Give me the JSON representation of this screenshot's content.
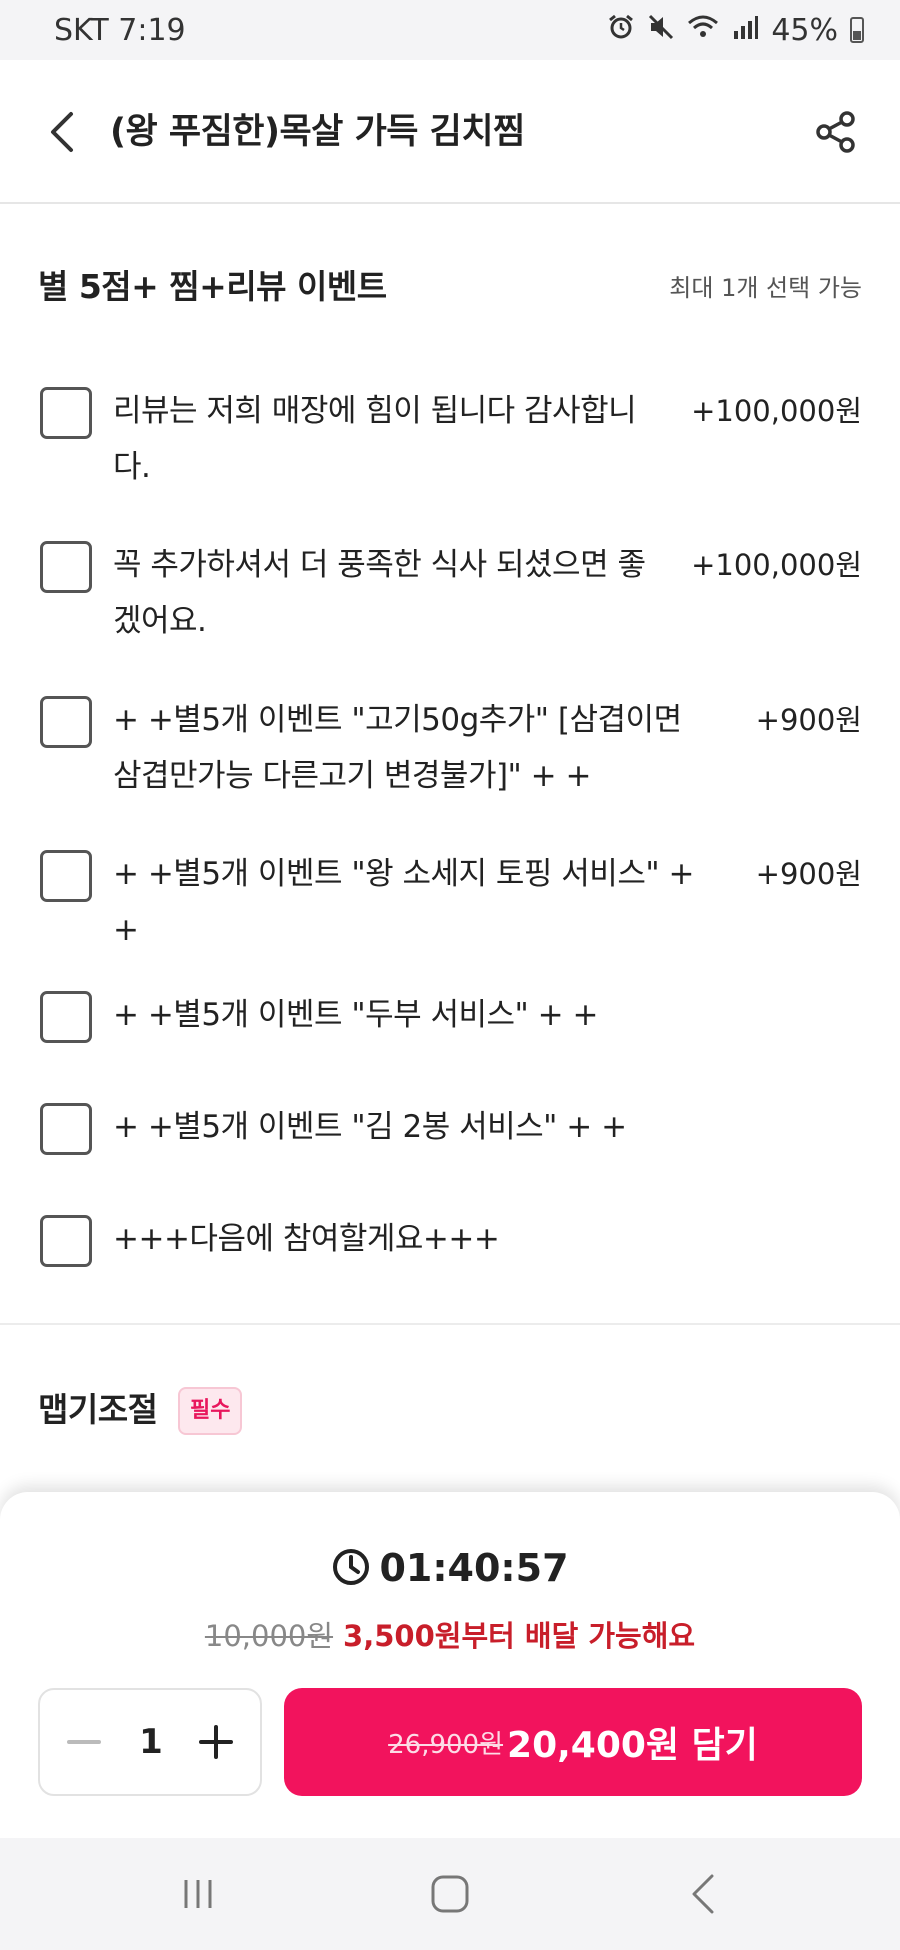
{
  "status_bar": {
    "carrier_time": "SKT 7:19",
    "battery": "45%",
    "icons": [
      "alarm-icon",
      "mute-icon",
      "wifi-icon",
      "signal-icon",
      "battery-icon"
    ]
  },
  "header": {
    "title": "(왕 푸짐한)목살 가득 김치찜",
    "back_icon": "back-arrow-icon",
    "share_icon": "share-icon"
  },
  "option_group": {
    "title": "별 5점+ 찜+리뷰 이벤트",
    "limit": "최대 1개 선택 가능",
    "options": [
      {
        "label": "리뷰는 저희 매장에 힘이 됩니다 감사합니다.",
        "price": "+100,000원",
        "checked": false
      },
      {
        "label": "꼭 추가하셔서 더 풍족한 식사 되셨으면 좋겠어요.",
        "price": "+100,000원",
        "checked": false
      },
      {
        "label": "+ +별5개 이벤트 \"고기50g추가\"  [삼겹이면 삼겹만가능 다른고기 변경불가]\" + +",
        "price": "+900원",
        "checked": false
      },
      {
        "label": "+ +별5개 이벤트 \"왕 소세지 토핑 서비스\" + +",
        "price": "+900원",
        "checked": false
      },
      {
        "label": "+ +별5개 이벤트 \"두부 서비스\" + +",
        "price": "",
        "checked": false
      },
      {
        "label": "+ +별5개 이벤트 \"김 2봉 서비스\" + +",
        "price": "",
        "checked": false
      },
      {
        "label": "+++다음에 참여할게요+++",
        "price": "",
        "checked": false
      }
    ]
  },
  "spicy_group": {
    "title": "맵기조절",
    "badge": "필수"
  },
  "bottom_sheet": {
    "timer": "01:40:57",
    "delivery_fee_old": "10,000원",
    "delivery_fee_new": "3,500원부터 배달 가능해요",
    "quantity": "1",
    "minus": "−",
    "plus": "+",
    "price_old": "26,900원",
    "add_label": "20,400원 담기"
  },
  "colors": {
    "accent": "#f2135d",
    "delivery_red": "#c81e2a",
    "badge_bg": "#fde8ee"
  }
}
